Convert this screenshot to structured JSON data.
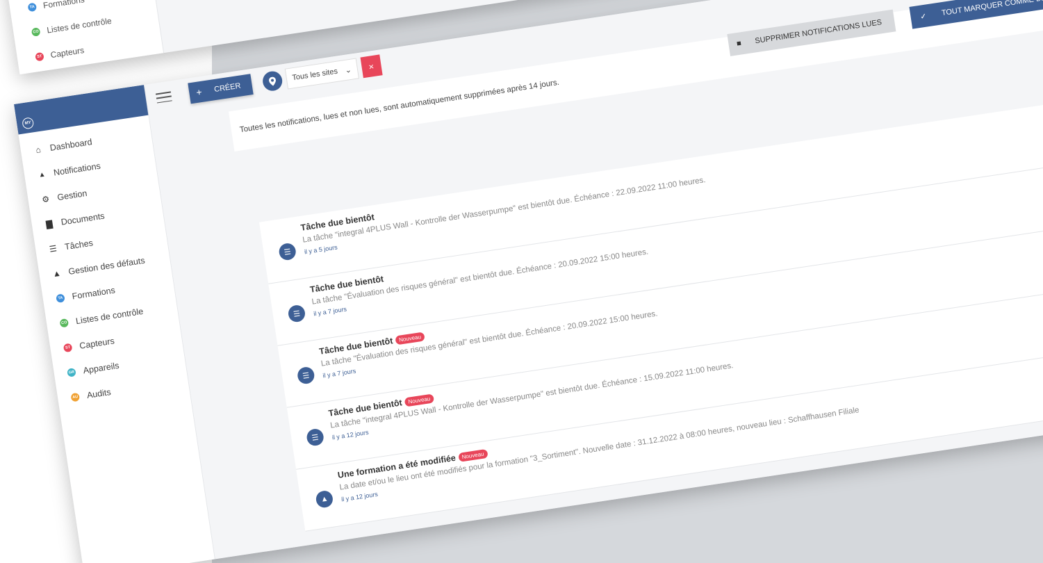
{
  "back_sidebar": {
    "items": [
      {
        "label": "Formations",
        "badge": "TA",
        "color": "#3f8fdb"
      },
      {
        "label": "Listes de contrôle",
        "badge": "CO",
        "color": "#58b85c"
      },
      {
        "label": "Capteurs",
        "badge": "ST",
        "color": "#e8465a"
      }
    ]
  },
  "sidebar": {
    "logo": "MY",
    "items": [
      {
        "label": "Dashboard",
        "icon": "home-icon",
        "glyph": "⌂"
      },
      {
        "label": "Notifications",
        "icon": "bell-icon",
        "glyph": "🔔"
      },
      {
        "label": "Gestion",
        "icon": "gear-icon",
        "glyph": "⚙"
      },
      {
        "label": "Documents",
        "icon": "folder-icon",
        "glyph": "▇"
      },
      {
        "label": "Tâches",
        "icon": "list-icon",
        "glyph": "☰"
      },
      {
        "label": "Gestion des défauts",
        "icon": "warning-icon",
        "glyph": "▲"
      },
      {
        "label": "Formations",
        "icon": "formations-dot-icon",
        "badge": "TA",
        "color": "#3f8fdb"
      },
      {
        "label": "Listes de contrôle",
        "icon": "checklist-dot-icon",
        "badge": "CO",
        "color": "#58b85c"
      },
      {
        "label": "Capteurs",
        "icon": "sensor-dot-icon",
        "badge": "ST",
        "color": "#e8465a"
      },
      {
        "label": "Appareils",
        "icon": "device-dot-icon",
        "badge": "GR",
        "color": "#3fb3c6"
      },
      {
        "label": "Audits",
        "icon": "audit-dot-icon",
        "badge": "AU",
        "color": "#f0a132"
      }
    ]
  },
  "topbar": {
    "create_label": "CRÉER",
    "site_select": "Tous les sites",
    "clear_label": "×"
  },
  "info": {
    "text": "Toutes les notifications, lues et non lues, sont automatiquement supprimées après 14 jours.",
    "delete_label": "SUPPRIMER NOTIFICATIONS LUES",
    "mark_read_label": "TOUT MARQUER COMME LU"
  },
  "notifications": [
    {
      "title": "Tâche due bientôt",
      "badge": "",
      "message": "La tâche \"integral 4PLUS Wall - Kontrolle der Wasserpumpe\" est bientôt due. Échéance : 22.09.2022 11:00 heures.",
      "time": "il y a 5 jours",
      "icon": "tasks-icon"
    },
    {
      "title": "Tâche due bientôt",
      "badge": "",
      "message": "La tâche \"Évaluation des risques général\" est bientôt due. Échéance : 20.09.2022 15:00 heures.",
      "time": "il y a 7 jours",
      "icon": "tasks-icon"
    },
    {
      "title": "Tâche due bientôt",
      "badge": "Nouveau",
      "message": "La tâche \"Évaluation des risques général\" est bientôt due. Échéance : 20.09.2022 15:00 heures.",
      "time": "il y a 7 jours",
      "icon": "tasks-icon"
    },
    {
      "title": "Tâche due bientôt",
      "badge": "Nouveau",
      "message": "La tâche \"integral 4PLUS Wall - Kontrolle der Wasserpumpe\" est bientôt due. Échéance : 15.09.2022 11:00 heures.",
      "time": "il y a 12 jours",
      "icon": "tasks-icon"
    },
    {
      "title": "Une formation a été modifiée",
      "badge": "Nouveau",
      "message": "La date et/ou le lieu ont été modifiés pour la formation \"3_Sortiment\". Nouvelle date : 31.12.2022 à 08:00 heures, nouveau lieu : Schaffhausen Filiale",
      "time": "il y a 12 jours",
      "icon": "graduation-cap-icon"
    }
  ]
}
